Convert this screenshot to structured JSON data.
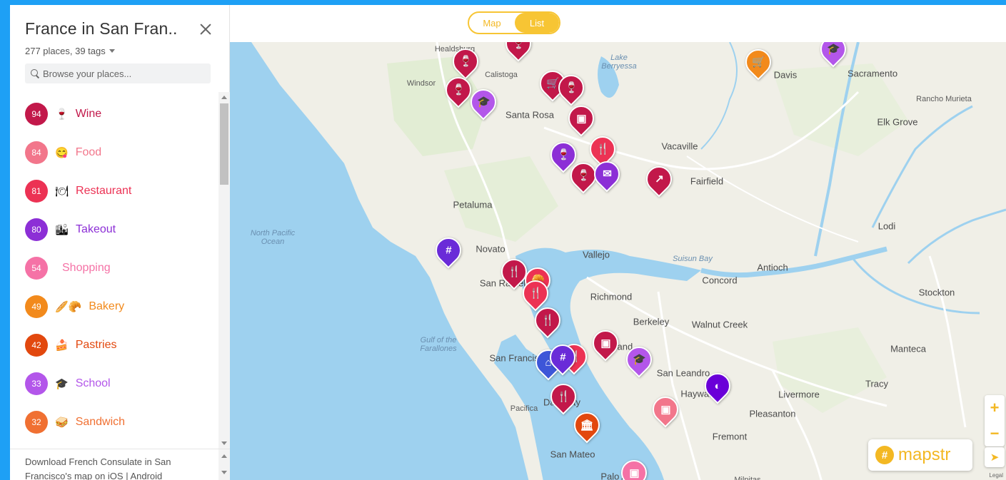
{
  "sidebar": {
    "title": "France in San Fran..",
    "subtitle": "277 places, 39 tags",
    "search_placeholder": "Browse your places...",
    "tags": [
      {
        "count": "94",
        "emoji": "🍷",
        "label": "Wine",
        "color": "#c2184a"
      },
      {
        "count": "84",
        "emoji": "😋",
        "label": "Food",
        "color": "#f2768b"
      },
      {
        "count": "81",
        "emoji": "🍽",
        "label": "Restaurant",
        "color": "#ec3254"
      },
      {
        "count": "80",
        "emoji": "🏙",
        "label": "Takeout",
        "color": "#8c2fd6"
      },
      {
        "count": "54",
        "emoji": "",
        "label": "Shopping",
        "color": "#f572a6"
      },
      {
        "count": "49",
        "emoji": "🥖🥐",
        "label": "Bakery",
        "color": "#f28a1c"
      },
      {
        "count": "42",
        "emoji": "🍰",
        "label": "Pastries",
        "color": "#e2480e"
      },
      {
        "count": "33",
        "emoji": "🎓",
        "label": "School",
        "color": "#b356ea"
      },
      {
        "count": "32",
        "emoji": "🥪",
        "label": "Sandwich",
        "color": "#f07032"
      }
    ],
    "footer_line1": "Download French Consulate in San",
    "footer_line2": "Francisco's map on iOS | Android"
  },
  "toggle": {
    "map_label": "Map",
    "list_label": "List"
  },
  "brand": {
    "logo_glyph": "#",
    "name": "mapstr"
  },
  "map": {
    "places": [
      {
        "name": "Healdsburg",
        "type": "town"
      },
      {
        "name": "Calistoga",
        "type": "town"
      },
      {
        "name": "Windsor",
        "type": "town"
      },
      {
        "name": "Santa Rosa",
        "type": "city"
      },
      {
        "name": "Lake Berryessa",
        "type": "water"
      },
      {
        "name": "Davis",
        "type": "city"
      },
      {
        "name": "Sacramento",
        "type": "city"
      },
      {
        "name": "Rancho Murieta",
        "type": "town"
      },
      {
        "name": "Elk Grove",
        "type": "city"
      },
      {
        "name": "Vacaville",
        "type": "city"
      },
      {
        "name": "Fairfield",
        "type": "city"
      },
      {
        "name": "Petaluma",
        "type": "city"
      },
      {
        "name": "North Pacific Ocean",
        "type": "water"
      },
      {
        "name": "Novato",
        "type": "city"
      },
      {
        "name": "Vallejo",
        "type": "city"
      },
      {
        "name": "Suisun Bay",
        "type": "water"
      },
      {
        "name": "Concord",
        "type": "city"
      },
      {
        "name": "Antioch",
        "type": "city"
      },
      {
        "name": "Lodi",
        "type": "city"
      },
      {
        "name": "Stockton",
        "type": "city"
      },
      {
        "name": "San Rafael",
        "type": "city"
      },
      {
        "name": "Richmond",
        "type": "city"
      },
      {
        "name": "Berkeley",
        "type": "city"
      },
      {
        "name": "Walnut Creek",
        "type": "city"
      },
      {
        "name": "Gulf of the Farallones",
        "type": "water"
      },
      {
        "name": "San Francisco",
        "type": "city"
      },
      {
        "name": "Oakland",
        "type": "city"
      },
      {
        "name": "San Leandro",
        "type": "city"
      },
      {
        "name": "Hayward",
        "type": "city"
      },
      {
        "name": "Livermore",
        "type": "city"
      },
      {
        "name": "Pleasanton",
        "type": "city"
      },
      {
        "name": "Tracy",
        "type": "city"
      },
      {
        "name": "Manteca",
        "type": "city"
      },
      {
        "name": "Daly City",
        "type": "city"
      },
      {
        "name": "Pacifica",
        "type": "town"
      },
      {
        "name": "Fremont",
        "type": "city"
      },
      {
        "name": "San Mateo",
        "type": "city"
      },
      {
        "name": "Palo Alto",
        "type": "city"
      },
      {
        "name": "Milpitas",
        "type": "town"
      }
    ],
    "pins": [
      {
        "icon": "wine-icon",
        "glyph": "🍷",
        "color": "#c2184a"
      },
      {
        "icon": "wine-icon",
        "glyph": "🍷",
        "color": "#c2184a"
      },
      {
        "icon": "wine-icon",
        "glyph": "🍷",
        "color": "#c2184a"
      },
      {
        "icon": "school-icon",
        "glyph": "🎓",
        "color": "#b356ea"
      },
      {
        "icon": "cart-icon",
        "glyph": "🛒",
        "color": "#c2184a"
      },
      {
        "icon": "wine-icon",
        "glyph": "🍷",
        "color": "#c2184a"
      },
      {
        "icon": "photo-icon",
        "glyph": "▣",
        "color": "#c2184a"
      },
      {
        "icon": "cart-icon",
        "glyph": "🛒",
        "color": "#f28a1c"
      },
      {
        "icon": "school-icon",
        "glyph": "🎓",
        "color": "#b356ea"
      },
      {
        "icon": "wine-icon",
        "glyph": "🍷",
        "color": "#8c2fd6"
      },
      {
        "icon": "restaurant-icon",
        "glyph": "🍴",
        "color": "#ec3254"
      },
      {
        "icon": "wine-icon",
        "glyph": "🍷",
        "color": "#c2184a"
      },
      {
        "icon": "mail-icon",
        "glyph": "✉",
        "color": "#8c2fd6"
      },
      {
        "icon": "route-icon",
        "glyph": "↗",
        "color": "#c2184a"
      },
      {
        "icon": "hashtag-icon",
        "glyph": "#",
        "color": "#6a2bd8"
      },
      {
        "icon": "restaurant-icon",
        "glyph": "🍴",
        "color": "#c2184a"
      },
      {
        "icon": "bakery-icon",
        "glyph": "🥐",
        "color": "#ec3254"
      },
      {
        "icon": "restaurant-icon",
        "glyph": "🍴",
        "color": "#ec3254"
      },
      {
        "icon": "restaurant-icon",
        "glyph": "🍴",
        "color": "#c2184a"
      },
      {
        "icon": "bag-icon",
        "glyph": "▣",
        "color": "#c2184a"
      },
      {
        "icon": "restaurant-icon",
        "glyph": "🍴",
        "color": "#ec3254"
      },
      {
        "icon": "school-icon",
        "glyph": "🎓",
        "color": "#b356ea"
      },
      {
        "icon": "home-icon",
        "glyph": "⌂",
        "color": "#3d56d8"
      },
      {
        "icon": "hashtag-icon",
        "glyph": "#",
        "color": "#6a2bd8"
      },
      {
        "icon": "restaurant-icon",
        "glyph": "🍴",
        "color": "#c2184a"
      },
      {
        "icon": "bank-icon",
        "glyph": "🏛",
        "color": "#e2480e"
      },
      {
        "icon": "bag-icon",
        "glyph": "▣",
        "color": "#f2768b"
      },
      {
        "icon": "tag-icon",
        "glyph": "◐",
        "color": "#6a00d8"
      },
      {
        "icon": "bag-icon",
        "glyph": "▣",
        "color": "#f572a6"
      }
    ]
  }
}
